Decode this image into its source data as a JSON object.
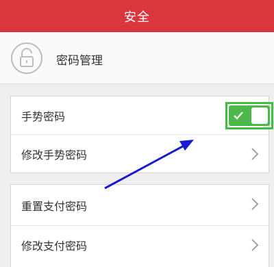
{
  "header": {
    "title": "安全"
  },
  "section": {
    "label": "密码管理",
    "icon": "lock-icon"
  },
  "gesture": {
    "toggle_label": "手势密码",
    "toggle_on": true,
    "modify_label": "修改手势密码"
  },
  "payment": {
    "reset_label": "重置支付密码",
    "modify_label": "修改支付密码"
  },
  "colors": {
    "header": "#d9363e",
    "toggle_on": "#4cb84c",
    "highlight": "#3fbf3f",
    "arrow": "#1a1ad0"
  }
}
